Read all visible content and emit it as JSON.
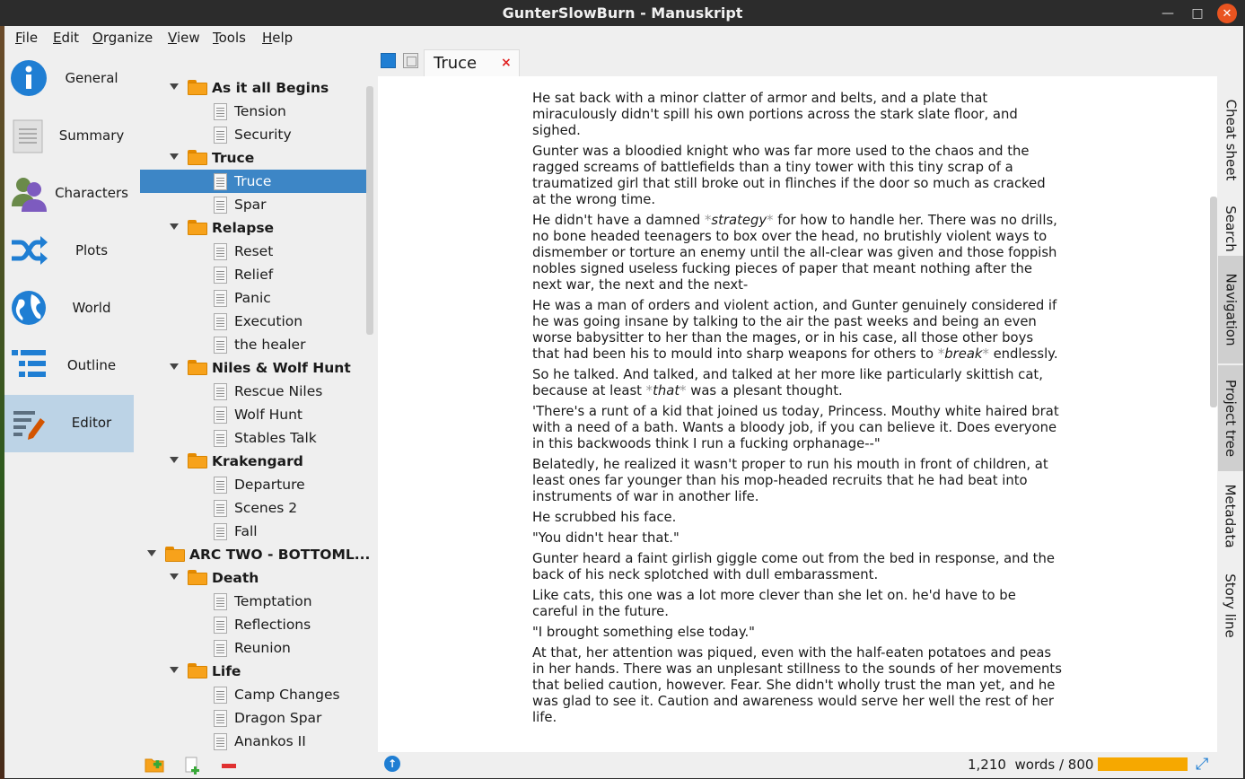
{
  "window": {
    "title": "GunterSlowBurn - Manuskript"
  },
  "menu": [
    {
      "pre": "",
      "u": "F",
      "post": "ile"
    },
    {
      "pre": "",
      "u": "E",
      "post": "dit"
    },
    {
      "pre": "",
      "u": "O",
      "post": "rganize"
    },
    {
      "pre": "",
      "u": "V",
      "post": "iew"
    },
    {
      "pre": "",
      "u": "T",
      "post": "ools"
    },
    {
      "pre": "",
      "u": "H",
      "post": "elp"
    }
  ],
  "sidebar": {
    "items": [
      {
        "label": "General",
        "icon": "info-icon"
      },
      {
        "label": "Summary",
        "icon": "summary-icon"
      },
      {
        "label": "Characters",
        "icon": "characters-icon"
      },
      {
        "label": "Plots",
        "icon": "shuffle-icon"
      },
      {
        "label": "World",
        "icon": "globe-icon"
      },
      {
        "label": "Outline",
        "icon": "outline-icon"
      },
      {
        "label": "Editor",
        "icon": "editor-icon"
      }
    ],
    "active": "Editor"
  },
  "tree": [
    {
      "label": "As it all Begins",
      "type": "folder",
      "depth": 1,
      "expanded": true
    },
    {
      "label": "Tension",
      "type": "doc",
      "depth": 2
    },
    {
      "label": "Security",
      "type": "doc",
      "depth": 2
    },
    {
      "label": "Truce",
      "type": "folder",
      "depth": 1,
      "expanded": true
    },
    {
      "label": "Truce",
      "type": "doc",
      "depth": 2,
      "selected": true
    },
    {
      "label": "Spar",
      "type": "doc",
      "depth": 2
    },
    {
      "label": "Relapse",
      "type": "folder",
      "depth": 1,
      "expanded": true
    },
    {
      "label": "Reset",
      "type": "doc",
      "depth": 2
    },
    {
      "label": "Relief",
      "type": "doc",
      "depth": 2
    },
    {
      "label": "Panic",
      "type": "doc",
      "depth": 2
    },
    {
      "label": "Execution",
      "type": "doc",
      "depth": 2
    },
    {
      "label": "the healer",
      "type": "doc",
      "depth": 2
    },
    {
      "label": "Niles & Wolf Hunt",
      "type": "folder",
      "depth": 1,
      "expanded": true
    },
    {
      "label": "Rescue Niles",
      "type": "doc",
      "depth": 2
    },
    {
      "label": "Wolf Hunt",
      "type": "doc",
      "depth": 2
    },
    {
      "label": "Stables Talk",
      "type": "doc",
      "depth": 2
    },
    {
      "label": "Krakengard",
      "type": "folder",
      "depth": 1,
      "expanded": true
    },
    {
      "label": "Departure",
      "type": "doc",
      "depth": 2
    },
    {
      "label": "Scenes 2",
      "type": "doc",
      "depth": 2
    },
    {
      "label": "Fall",
      "type": "doc",
      "depth": 2
    },
    {
      "label": "ARC TWO - BOTTOML...",
      "type": "folder",
      "depth": 0,
      "expanded": true
    },
    {
      "label": "Death",
      "type": "folder",
      "depth": 1,
      "expanded": true
    },
    {
      "label": "Temptation",
      "type": "doc",
      "depth": 2
    },
    {
      "label": "Reflections",
      "type": "doc",
      "depth": 2
    },
    {
      "label": "Reunion",
      "type": "doc",
      "depth": 2
    },
    {
      "label": "Life",
      "type": "folder",
      "depth": 1,
      "expanded": true
    },
    {
      "label": "Camp Changes",
      "type": "doc",
      "depth": 2
    },
    {
      "label": "Dragon Spar",
      "type": "doc",
      "depth": 2
    },
    {
      "label": "Anankos II",
      "type": "doc",
      "depth": 2
    }
  ],
  "tree_tools": [
    "add-folder-icon",
    "add-document-icon",
    "remove-icon"
  ],
  "editor": {
    "tab": {
      "label": "Truce",
      "close": "×"
    },
    "paragraphs": [
      [
        {
          "t": "He sat back with a minor clatter of armor and belts, and a plate that miraculously didn't spill his own portions across the stark slate floor, and sighed."
        }
      ],
      [
        {
          "t": "Gunter was a bloodied knight who was far more used to the chaos and the ragged screams of battlefields than a tiny tower with this tiny scrap of a traumatized girl that still broke out in flinches if the door so much as cracked at the wrong time."
        }
      ],
      [
        {
          "t": "He didn't have a damned "
        },
        {
          "m": "*"
        },
        {
          "e": "strategy"
        },
        {
          "m": "*"
        },
        {
          "t": " for how to handle her. There was no drills, no bone headed teenagers to box over the head, no brutishly violent ways to dismember or torture an enemy until the all-clear was given and those foppish nobles signed useless fucking pieces of paper that meant nothing after the next war, the next and the next-"
        }
      ],
      [
        {
          "t": "He was a man of orders and violent action, and Gunter genuinely considered if he was going insane by talking to the air the past weeks and being an even worse babysitter to her than the mages, or in his case, all those other boys that had been his to mould into sharp weapons for others to "
        },
        {
          "m": "*"
        },
        {
          "e": "break"
        },
        {
          "m": "*"
        },
        {
          "t": " endlessly."
        }
      ],
      [
        {
          "t": "So he talked. And talked, and talked at her more like particularly skittish cat, because at least "
        },
        {
          "m": "*"
        },
        {
          "e": "that"
        },
        {
          "m": "*"
        },
        {
          "t": " was a plesant thought."
        }
      ],
      [
        {
          "t": "'There's a runt of a kid that joined us today, Princess. Mouthy white haired brat with a need of a bath. Wants a bloody job, if you can believe it. Does everyone in this backwoods think I run a fucking orphanage--\""
        }
      ],
      [
        {
          "t": "Belatedly, he realized it wasn't proper to run his mouth in front of children, at least ones far younger than his mop-headed recruits that he had beat into instruments of war in another life."
        }
      ],
      [
        {
          "t": "He scrubbed his face."
        }
      ],
      [
        {
          "t": "\"You didn't hear that.\""
        }
      ],
      [
        {
          "t": "Gunter heard a faint girlish giggle come out from the bed in response, and the back of his neck splotched with dull embarassment."
        }
      ],
      [
        {
          "t": "Like cats, this one was a lot more clever than she let on. he'd have to be careful in the future."
        }
      ],
      [
        {
          "t": "\"I brought something else today.\""
        }
      ],
      [
        {
          "t": "At that, her attention was piqued, even with the half-eaten potatoes and peas in her hands. There was an unplesant stillness to the sounds of her movements that belied caution, however. Fear. She didn't wholly trust the man yet, and he was glad to see it. Caution and awareness would serve her well the rest of her life."
        }
      ]
    ]
  },
  "dock_tabs": [
    {
      "label": "Cheat sheet",
      "active": false
    },
    {
      "label": "Search",
      "active": false
    },
    {
      "label": "Navigation",
      "active": true
    },
    {
      "label": "Project tree",
      "active": true
    },
    {
      "label": "Metadata",
      "active": false
    },
    {
      "label": "Story line",
      "active": false
    }
  ],
  "status": {
    "word_count": "1,210",
    "goal_text": "words / 800",
    "goal_progress": 1.0,
    "progress_color": "#f6a800"
  },
  "colors": {
    "accent": "#3d86c6",
    "brand_blue": "#1f7ed3",
    "close_red": "#e95420"
  }
}
